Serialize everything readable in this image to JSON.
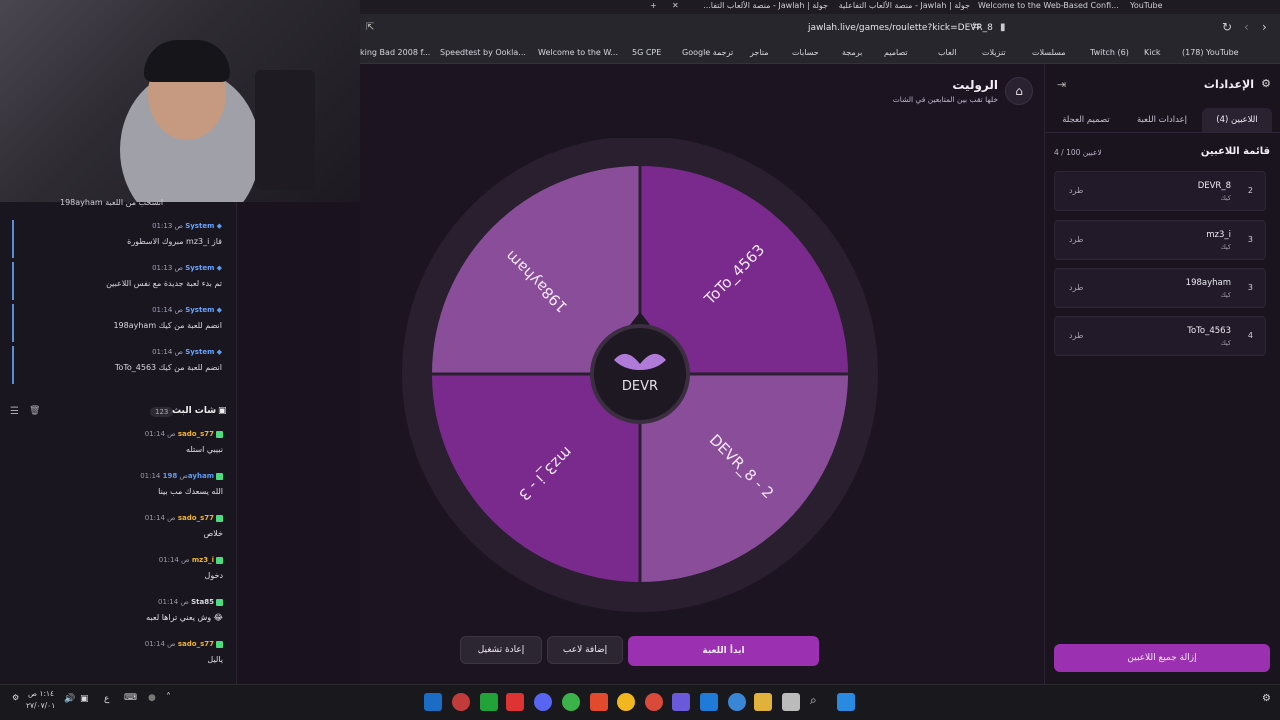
{
  "browser": {
    "tabs": [
      "Welcome to the Web-Based Confi...",
      "جولة | Jawlah - منصة الألعاب التفا...",
      "جولة | Jawlah - منصة الألعاب التفاعلية",
      "YouTube"
    ],
    "url": "jawlah.live/games/roulette?kick=DEVR_8",
    "bookmarks": [
      "king Bad 2008 f...",
      "Speedtest by Ookla...",
      "Welcome to the W...",
      "5G CPE",
      "Google ترجمة",
      "متاجر",
      "حسابات",
      "برمجة",
      "تصاميم",
      "العاب",
      "تنزيلات",
      "مسلسلات",
      "Twitch (6)",
      "Kick",
      "(178) YouTube"
    ]
  },
  "left_chat": {
    "partial_message": "198ayham انسحب من اللعبة",
    "system_messages": [
      {
        "who": "System",
        "time": "01:13 ص",
        "text": "مبروك الاسطورة mz3_i فاز"
      },
      {
        "who": "System",
        "time": "01:13 ص",
        "text": "تم بدء لعبة جديدة مع نفس اللاعبين"
      },
      {
        "who": "System",
        "time": "01:14 ص",
        "text": "198ayham انضم للعبة من كيك"
      },
      {
        "who": "System",
        "time": "01:14 ص",
        "text": "ToTo_4563 انضم للعبة من كيك"
      }
    ],
    "header": {
      "title": "شات البث",
      "count": "123"
    },
    "messages": [
      {
        "who": "sado_s77",
        "time": "01:14 ص",
        "text": "نبيبي استله",
        "color": "#f0b429"
      },
      {
        "who": "198ayham",
        "time": "01:14 ص",
        "text": "الله يسعدك مب بينا",
        "color": "#5b9cf6"
      },
      {
        "who": "sado_s77",
        "time": "01:14 ص",
        "text": "خلاص",
        "color": "#f0b429"
      },
      {
        "who": "mz3_i",
        "time": "01:14 ص",
        "text": "دخول",
        "color": "#f0b429"
      },
      {
        "who": "Sta85",
        "time": "01:14 ص",
        "text": "وش يعني تراها لعبه 😂",
        "color": "#d8d8e0"
      },
      {
        "who": "sado_s77",
        "time": "01:14 ص",
        "text": "ياليل",
        "color": "#f0b429"
      }
    ]
  },
  "game": {
    "title": "الروليت",
    "subtitle": "خلها تقب بين المتابعين في الشات",
    "wheel_center_label": "DEVR",
    "segments": [
      {
        "label": "198ayham",
        "color": "#8a4d9a"
      },
      {
        "label": "ToTo_4563",
        "color": "#7a2a8c"
      },
      {
        "label": "DEVR_8 - 2",
        "color": "#8a4d9a"
      },
      {
        "label": "mz3_i - 3",
        "color": "#7a2a8c"
      }
    ],
    "buttons": {
      "start": "ابدأ اللعبة",
      "add_player": "إضافة لاعب",
      "restart": "إعادة تشغيل"
    }
  },
  "settings": {
    "title": "الإعدادات",
    "tabs": [
      "اللاعبين (4)",
      "إعدادات اللعبة",
      "تصميم العجلة"
    ],
    "list_title": "قائمة اللاعبين",
    "count": "4 / 100 لاعبين",
    "players": [
      {
        "name": "DEVR_8",
        "source": "كيك",
        "number": "2",
        "kick": "طرد"
      },
      {
        "name": "mz3_i",
        "source": "كيك",
        "number": "3",
        "kick": "طرد"
      },
      {
        "name": "198ayham",
        "source": "كيك",
        "number": "3",
        "kick": "طرد"
      },
      {
        "name": "ToTo_4563",
        "source": "كيك",
        "number": "4",
        "kick": "طرد"
      }
    ],
    "remove_all": "إزالة جميع اللاعبين"
  },
  "taskbar": {
    "time": "١:١٤ ص",
    "date": "٢٧/٠٧/٠١",
    "lang": "ع"
  },
  "colors": {
    "accent": "#9b30b0",
    "accent_light": "#a13cb8"
  }
}
